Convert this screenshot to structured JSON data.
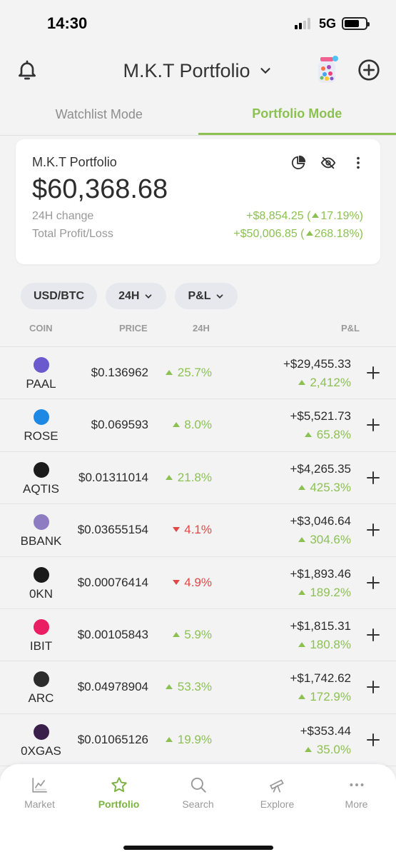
{
  "status": {
    "time": "14:30",
    "network": "5G"
  },
  "header": {
    "title": "M.K.T Portfolio"
  },
  "tabs": [
    {
      "label": "Watchlist Mode",
      "active": false
    },
    {
      "label": "Portfolio Mode",
      "active": true
    }
  ],
  "summary": {
    "name": "M.K.T Portfolio",
    "value": "$60,368.68",
    "change_label": "24H change",
    "change_value": "+$8,854.25 (",
    "change_pct": "17.19%)",
    "pl_label": "Total Profit/Loss",
    "pl_value": "+$50,006.85 (",
    "pl_pct": "268.18%)"
  },
  "filters": {
    "currency": "USD/BTC",
    "period": "24H",
    "metric": "P&L"
  },
  "columns": {
    "coin": "COIN",
    "price": "PRICE",
    "change": "24H",
    "pnl": "P&L"
  },
  "rows": [
    {
      "symbol": "PAAL",
      "price": "$0.136962",
      "change": "25.7%",
      "dir": "up",
      "pnl": "+$29,455.33",
      "pnl_pct": "2,412%",
      "logo_color": "#6a5acd"
    },
    {
      "symbol": "ROSE",
      "price": "$0.069593",
      "change": "8.0%",
      "dir": "up",
      "pnl": "+$5,521.73",
      "pnl_pct": "65.8%",
      "logo_color": "#1e88e5"
    },
    {
      "symbol": "AQTIS",
      "price": "$0.01311014",
      "change": "21.8%",
      "dir": "up",
      "pnl": "+$4,265.35",
      "pnl_pct": "425.3%",
      "logo_color": "#1b1b1b"
    },
    {
      "symbol": "BBANK",
      "price": "$0.03655154",
      "change": "4.1%",
      "dir": "down",
      "pnl": "+$3,046.64",
      "pnl_pct": "304.6%",
      "logo_color": "#8e7cc3"
    },
    {
      "symbol": "0KN",
      "price": "$0.00076414",
      "change": "4.9%",
      "dir": "down",
      "pnl": "+$1,893.46",
      "pnl_pct": "189.2%",
      "logo_color": "#1b1b1b"
    },
    {
      "symbol": "IBIT",
      "price": "$0.00105843",
      "change": "5.9%",
      "dir": "up",
      "pnl": "+$1,815.31",
      "pnl_pct": "180.8%",
      "logo_color": "#e91e63"
    },
    {
      "symbol": "ARC",
      "price": "$0.04978904",
      "change": "53.3%",
      "dir": "up",
      "pnl": "+$1,742.62",
      "pnl_pct": "172.9%",
      "logo_color": "#2b2b2b"
    },
    {
      "symbol": "0XGAS",
      "price": "$0.01065126",
      "change": "19.9%",
      "dir": "up",
      "pnl": "+$353.44",
      "pnl_pct": "35.0%",
      "logo_color": "#3a1f4a"
    }
  ],
  "nav": [
    {
      "label": "Market",
      "icon": "chart-icon",
      "active": false
    },
    {
      "label": "Portfolio",
      "icon": "star-icon",
      "active": true
    },
    {
      "label": "Search",
      "icon": "search-icon",
      "active": false
    },
    {
      "label": "Explore",
      "icon": "telescope-icon",
      "active": false
    },
    {
      "label": "More",
      "icon": "more-icon",
      "active": false
    }
  ],
  "colors": {
    "accent": "#8cc152",
    "negative": "#e04848",
    "background": "#f3f3f4"
  }
}
